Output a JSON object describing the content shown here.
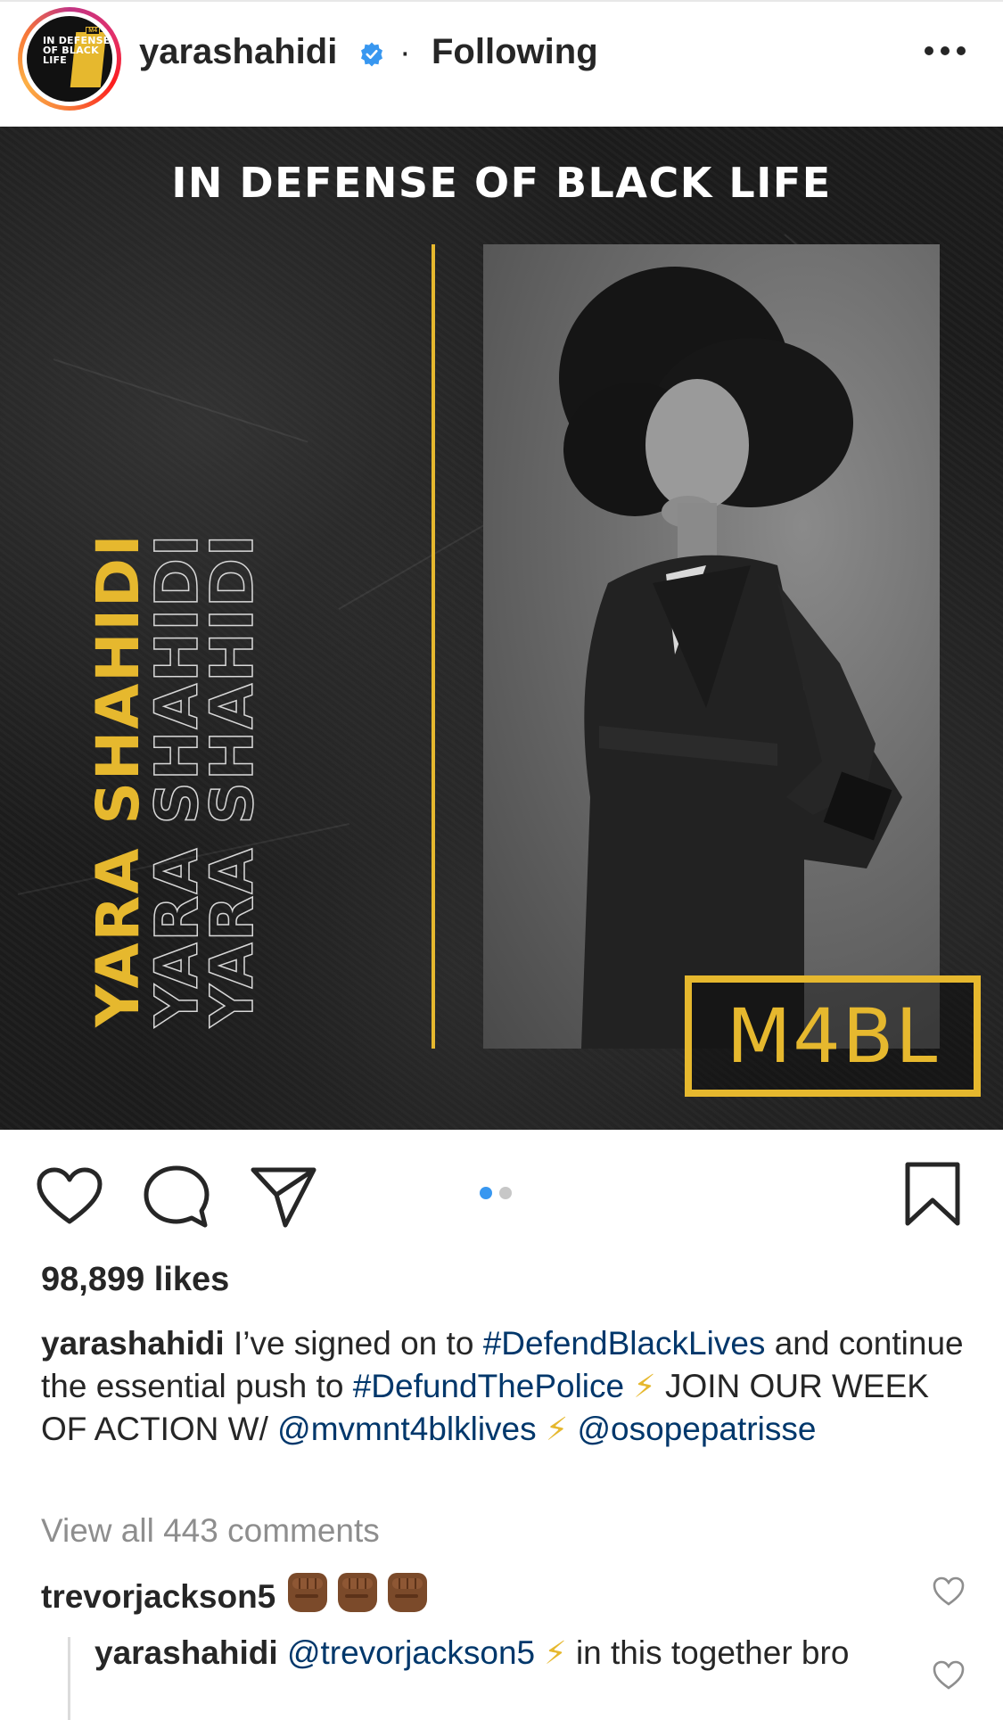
{
  "header": {
    "username": "yarashahidi",
    "separator": "·",
    "follow_status": "Following",
    "avatar_text": "IN DEFENSE OF BLACK LIFE",
    "verified_icon": "verified-badge-icon",
    "more_icon": "more-options-icon"
  },
  "post_image": {
    "title": "IN DEFENSE OF BLACK LIFE",
    "vertical_name": "YARA SHAHIDI",
    "logo_text": "M4BL",
    "accent_color": "#e6b82e"
  },
  "actions": {
    "like_icon": "heart-icon",
    "comment_icon": "comment-icon",
    "share_icon": "send-icon",
    "save_icon": "bookmark-icon",
    "carousel_pages": 2,
    "carousel_active": 1,
    "active_dot_color": "#3897f0",
    "inactive_dot_color": "#c7c7c7"
  },
  "likes": "98,899 likes",
  "caption": {
    "username": "yarashahidi",
    "text_1": "I’ve signed on to ",
    "tag_1": "#DefendBlackLives",
    "text_2": " and continue the essential push to ",
    "tag_2": "#DefundThePolice",
    "bolt_1": "⚡",
    "text_3": " JOIN OUR WEEK OF ACTION W/ ",
    "mention_1": "@mvmnt4blklives",
    "bolt_2": "⚡",
    "mention_2": "@osopepatrisse"
  },
  "view_all_comments": "View all 443 comments",
  "comments": [
    {
      "username": "trevorjackson5",
      "emoji": "✊🏾✊🏾✊🏾"
    }
  ],
  "reply": {
    "username": "yarashahidi",
    "mention": "@trevorjackson5",
    "bolt": "⚡",
    "text": " in this together bro"
  }
}
